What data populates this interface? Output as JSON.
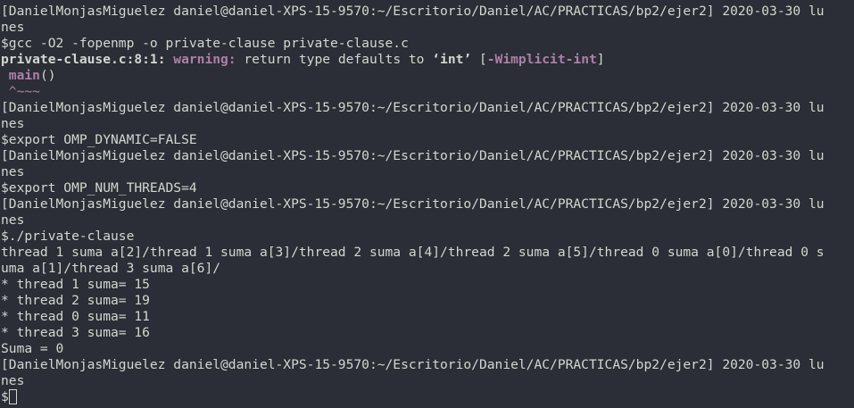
{
  "prompt": {
    "header": "[DanielMonjasMiguelez daniel@daniel-XPS-15-9570:~/Escritorio/Daniel/AC/PRACTICAS/bp2/ejer2] 2020-03-30 lu",
    "header_wrap": "nes",
    "symbol": "$"
  },
  "compile": {
    "command": "$gcc -O2 -fopenmp -o private-clause private-clause.c",
    "warning_location": "private-clause.c:8:1:",
    "warning_label": " warning:",
    "warning_text_before": " return type defaults to ",
    "warning_type": "‘int’",
    "warning_flag_open": " [",
    "warning_flag": "-Wimplicit-int",
    "warning_flag_close": "]",
    "source_line_indent": " ",
    "source_line": "main",
    "source_line_rest": "()",
    "caret_line": " ^~~~"
  },
  "commands": {
    "export_dynamic": "$export OMP_DYNAMIC=FALSE",
    "export_threads": "$export OMP_NUM_THREADS=4",
    "run": "$./private-clause"
  },
  "output": {
    "thread_line_1": "thread 1 suma a[2]/thread 1 suma a[3]/thread 2 suma a[4]/thread 2 suma a[5]/thread 0 suma a[0]/thread 0 s",
    "thread_line_2": "uma a[1]/thread 3 suma a[6]/",
    "sums": [
      "* thread 1 suma= 15",
      "* thread 2 suma= 19",
      "* thread 0 suma= 11",
      "* thread 3 suma= 16"
    ],
    "total": "Suma = 0"
  },
  "colors": {
    "background": "#2b2e36",
    "foreground": "#d3d7cf",
    "accent_magenta": "#ad7fa8"
  }
}
